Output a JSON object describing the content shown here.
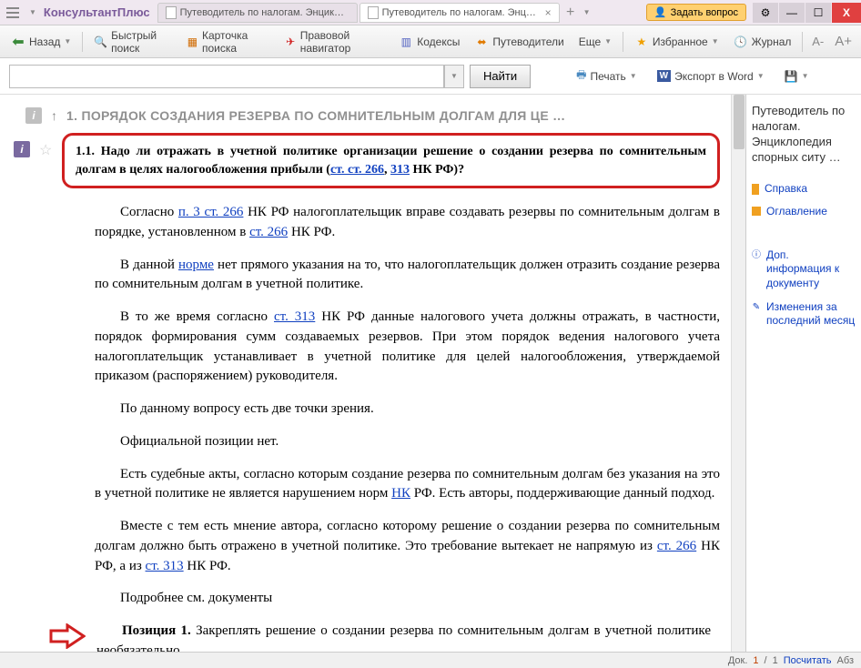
{
  "app_name": "КонсультантПлюс",
  "tabs": [
    {
      "label": "Путеводитель по налогам. Энциклопеди…",
      "active": false
    },
    {
      "label": "Путеводитель по налогам. Энциклопедия",
      "active": true
    }
  ],
  "ask_button": "Задать вопрос",
  "toolbar": {
    "back": "Назад",
    "quick_search": "Быстрый поиск",
    "card_search": "Карточка поиска",
    "legal_nav": "Правовой навигатор",
    "codes": "Кодексы",
    "guides": "Путеводители",
    "more": "Еще",
    "favorites": "Избранное",
    "journal": "Журнал"
  },
  "search": {
    "find_btn": "Найти",
    "print": "Печать",
    "export_word": "Экспорт в Word"
  },
  "breadcrumb": "1. ПОРЯДОК СОЗДАНИЯ РЕЗЕРВА ПО СОМНИТЕЛЬНЫМ ДОЛГАМ ДЛЯ ЦЕ  …",
  "highlight": {
    "prefix": "1.1. Надо ли отражать в учетной политике организации решение о создании резерва по сомнительным долгам в целях налогообложения прибыли (",
    "link1": "ст. ст. 266",
    "mid": ", ",
    "link2": "313",
    "suffix": " НК РФ)?"
  },
  "paras": {
    "p1a": "Согласно ",
    "p1_link": "п. 3 ст. 266",
    "p1b": " НК РФ налогоплательщик вправе создавать резервы по сомнительным долгам в порядке, установленном в ",
    "p1_link2": "ст. 266",
    "p1c": " НК РФ.",
    "p2a": "В данной ",
    "p2_link": "норме",
    "p2b": " нет прямого указания на то, что налогоплательщик должен отразить создание резерва по сомнительным долгам в учетной политике.",
    "p3a": "В то же время согласно ",
    "p3_link": "ст. 313",
    "p3b": " НК РФ данные налогового учета должны отражать, в частности, порядок формирования сумм создаваемых резервов. При этом порядок ведения налогового учета налогоплательщик устанавливает в учетной политике для целей налогообложения, утверждаемой приказом (распоряжением) руководителя.",
    "p4": "По данному вопросу есть две точки зрения.",
    "p5": "Официальной позиции нет.",
    "p6a": "Есть судебные акты, согласно которым создание резерва по сомнительным долгам без указания на это в учетной политике не является нарушением норм ",
    "p6_link": "НК",
    "p6b": " РФ. Есть авторы, поддерживающие данный подход.",
    "p7a": "Вместе с тем есть мнение автора, согласно которому решение о создании резерва по сомнительным долгам должно быть отражено в учетной политике. Это требование вытекает не напрямую из ",
    "p7_link1": "ст. 266",
    "p7b": " НК РФ, а из ",
    "p7_link2": "ст. 313",
    "p7c": " НК РФ.",
    "p8": "Подробнее см. документы",
    "pos_label": "Позиция 1.",
    "pos_text": " Закреплять решение о создании резерва по сомнительным долгам в учетной политике необязательно"
  },
  "sidebar": {
    "title": "Путеводитель по налогам. Энциклопедия спорных ситу …",
    "ref": "Справка",
    "toc": "Оглавление",
    "addinfo": "Доп. информация к документу",
    "changes": "Изменения за последний месяц"
  },
  "status": {
    "doc": "Док. ",
    "pos": "1",
    "sep": "/",
    "total": "1",
    "calc": "Посчитать",
    "abs": "Абз"
  }
}
